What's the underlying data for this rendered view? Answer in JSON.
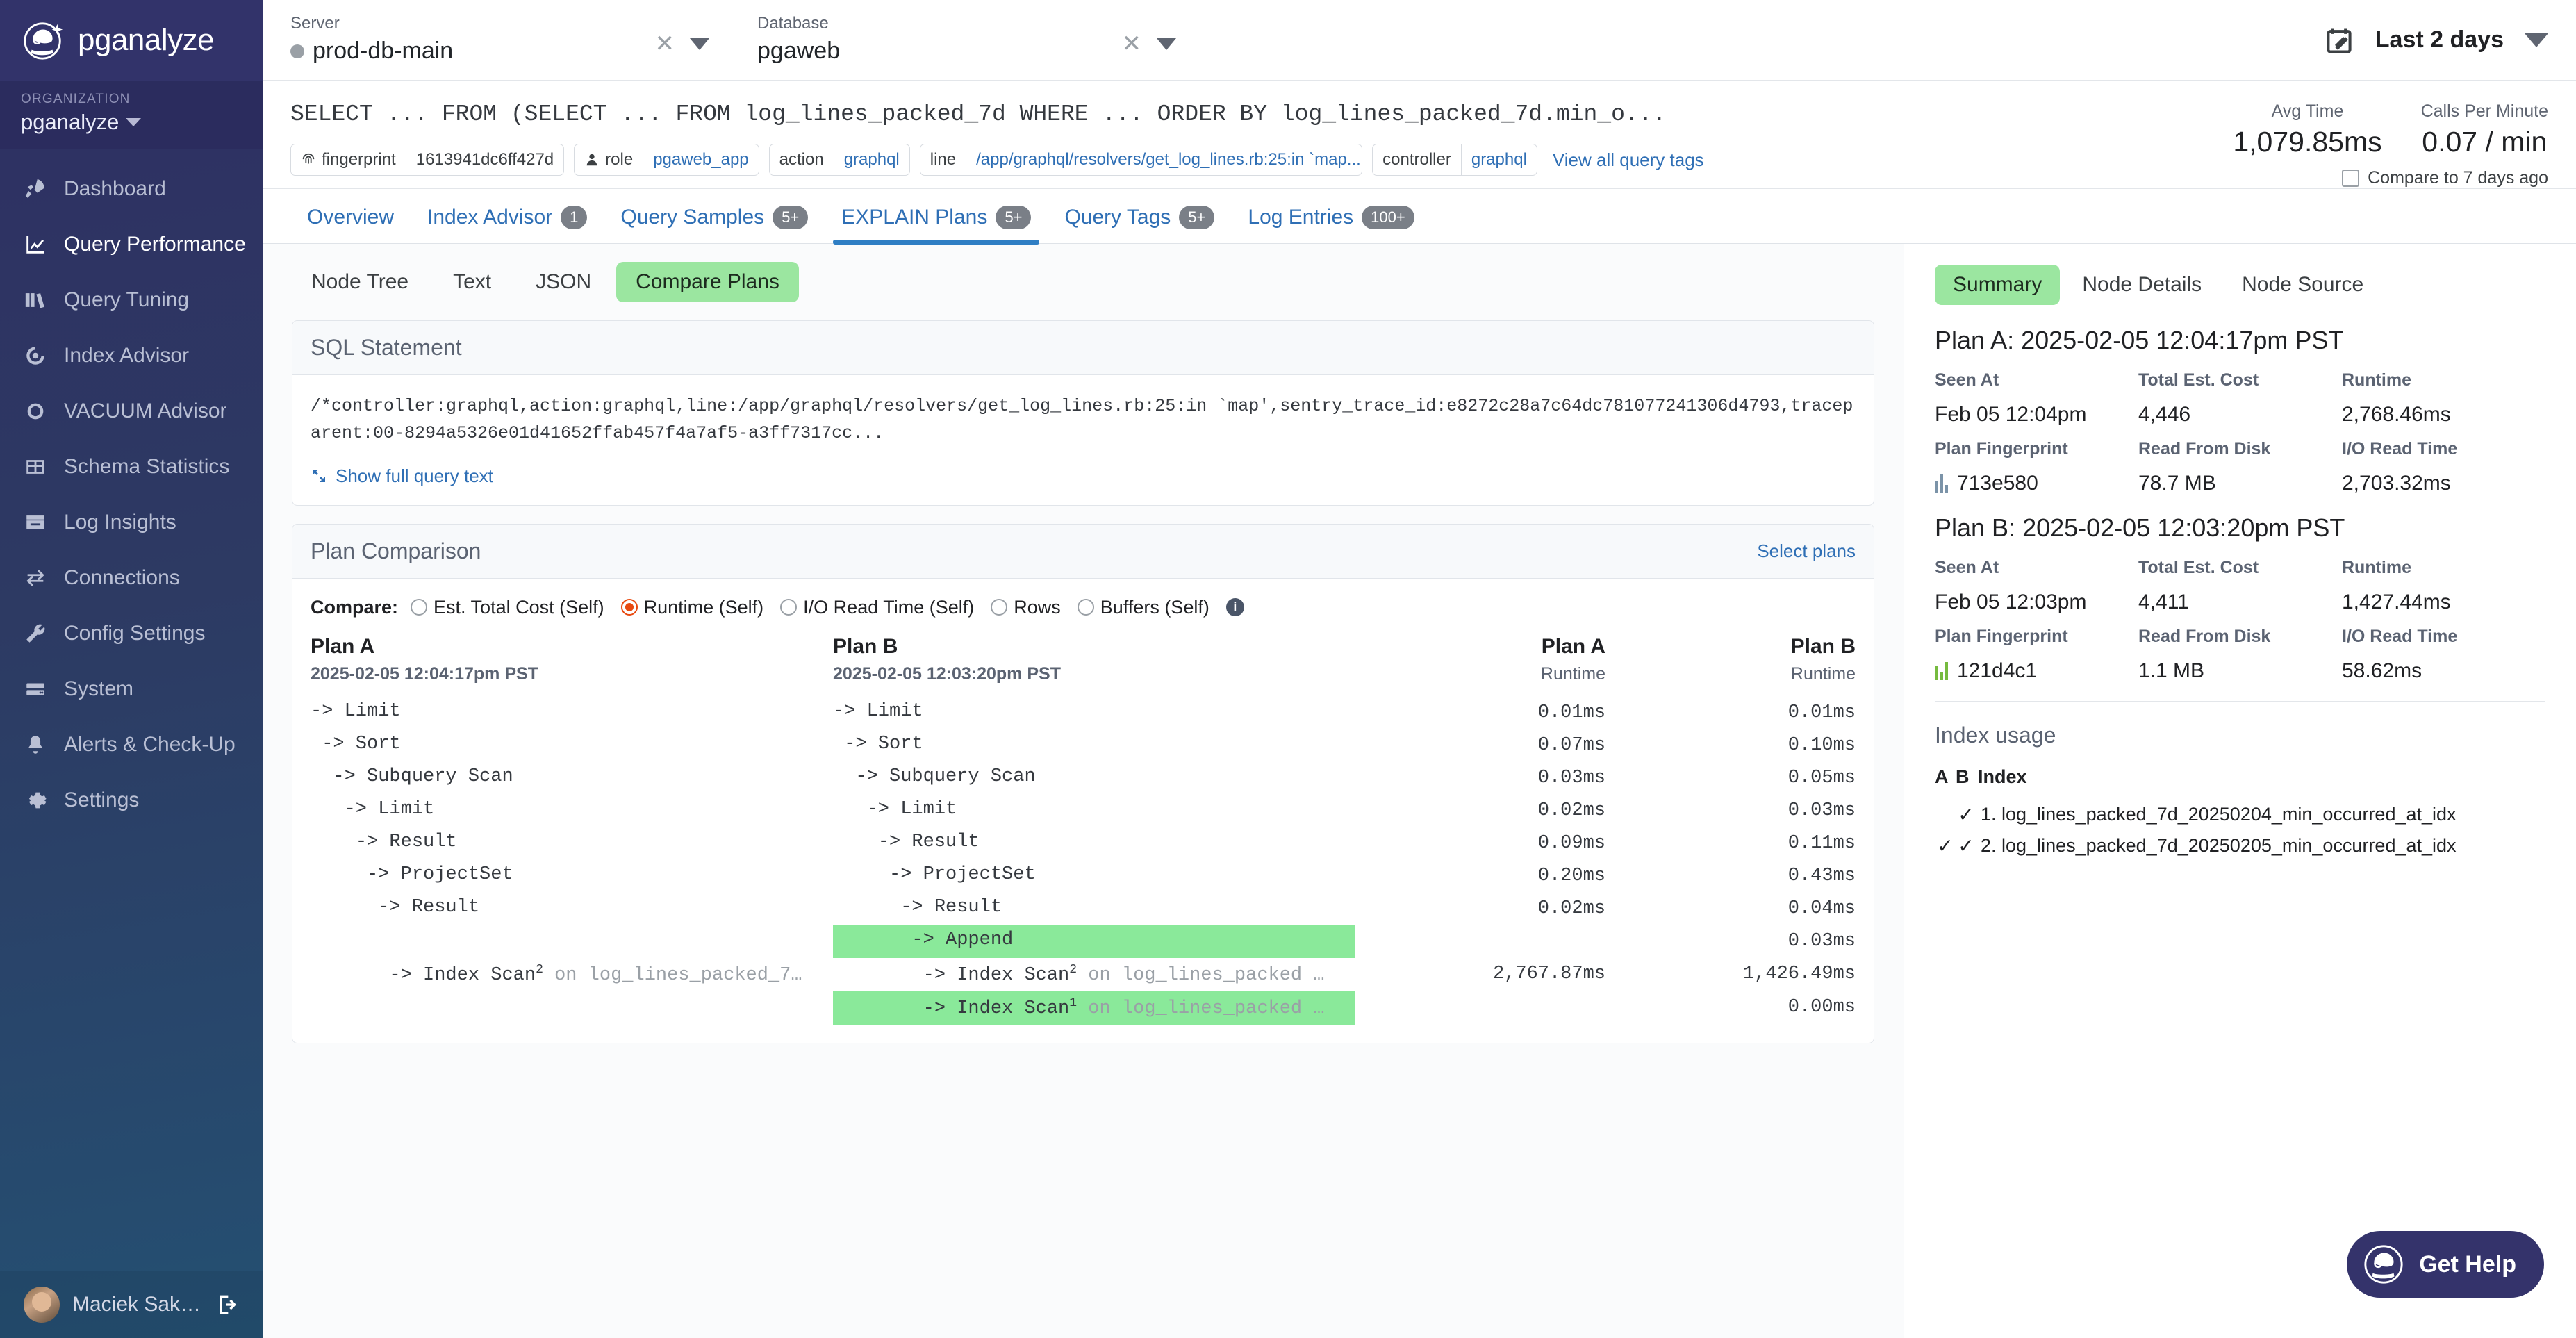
{
  "sidebar": {
    "brand": "pganalyze",
    "brand_logo_icon": "astronaut-helmet-icon",
    "org_label": "ORGANIZATION",
    "org_name": "pganalyze",
    "items": [
      {
        "label": "Dashboard",
        "icon": "rocket-icon",
        "active": false
      },
      {
        "label": "Query Performance",
        "icon": "chart-line-icon",
        "active": true
      },
      {
        "label": "Query Tuning",
        "icon": "books-icon",
        "active": false
      },
      {
        "label": "Index Advisor",
        "icon": "target-icon",
        "active": false
      },
      {
        "label": "VACUUM Advisor",
        "icon": "circle-icon",
        "active": false
      },
      {
        "label": "Schema Statistics",
        "icon": "table-icon",
        "active": false
      },
      {
        "label": "Log Insights",
        "icon": "log-box-icon",
        "active": false
      },
      {
        "label": "Connections",
        "icon": "arrows-swap-icon",
        "active": false
      },
      {
        "label": "Config Settings",
        "icon": "wrench-icon",
        "active": false
      },
      {
        "label": "System",
        "icon": "server-icon",
        "active": false
      },
      {
        "label": "Alerts & Check-Up",
        "icon": "bell-icon",
        "active": false
      },
      {
        "label": "Settings",
        "icon": "gear-icon",
        "active": false
      }
    ],
    "user": {
      "name": "Maciek Sak…",
      "logout_icon": "logout-icon",
      "avatar": "user-avatar"
    }
  },
  "topbar": {
    "server": {
      "label": "Server",
      "value": "prod-db-main",
      "clear_icon": "close-icon",
      "caret_icon": "chevron-down-icon"
    },
    "database": {
      "label": "Database",
      "value": "pgaweb",
      "clear_icon": "close-icon",
      "caret_icon": "chevron-down-icon"
    },
    "daterange": {
      "value": "Last 2 days",
      "calendar_icon": "calendar-edit-icon",
      "caret_icon": "chevron-down-icon"
    }
  },
  "query_header": {
    "title": "SELECT ... FROM (SELECT ... FROM log_lines_packed_7d WHERE ... ORDER BY log_lines_packed_7d.min_o...",
    "tags": [
      {
        "key": "fingerprint",
        "value": "1613941dc6ff427d",
        "icon": "fingerprint-icon",
        "link": false
      },
      {
        "key": "role",
        "value": "pgaweb_app",
        "icon": "user-icon",
        "link": true
      },
      {
        "key": "action",
        "value": "graphql",
        "icon": null,
        "link": true
      },
      {
        "key": "line",
        "value": "/app/graphql/resolvers/get_log_lines.rb:25:in `map...",
        "icon": null,
        "link": true
      },
      {
        "key": "controller",
        "value": "graphql",
        "icon": null,
        "link": true
      }
    ],
    "view_all_tags": "View all query tags",
    "metrics": [
      {
        "label": "Avg Time",
        "value": "1,079.85ms"
      },
      {
        "label": "Calls Per Minute",
        "value": "0.07 / min"
      }
    ],
    "compare_checkbox_label": "Compare to 7 days ago",
    "compare_checkbox_checked": false
  },
  "tabs": [
    {
      "label": "Overview",
      "badge": null,
      "active": false
    },
    {
      "label": "Index Advisor",
      "badge": "1",
      "active": false
    },
    {
      "label": "Query Samples",
      "badge": "5+",
      "active": false
    },
    {
      "label": "EXPLAIN Plans",
      "badge": "5+",
      "active": true
    },
    {
      "label": "Query Tags",
      "badge": "5+",
      "active": false
    },
    {
      "label": "Log Entries",
      "badge": "100+",
      "active": false
    }
  ],
  "subtabs": [
    {
      "label": "Node Tree",
      "active": false
    },
    {
      "label": "Text",
      "active": false
    },
    {
      "label": "JSON",
      "active": false
    },
    {
      "label": "Compare Plans",
      "active": true
    }
  ],
  "sql_panel": {
    "title": "SQL Statement",
    "text": "/*controller:graphql,action:graphql,line:/app/graphql/resolvers/get_log_lines.rb:25:in `map',sentry_trace_id:e8272c28a7c64dc781077241306d4793,traceparent:00-8294a5326e01d41652ffab457f4a7af5-a3ff7317cc...",
    "show_full_label": "Show full query text",
    "show_full_icon": "expand-icon"
  },
  "plan_comparison": {
    "title": "Plan Comparison",
    "select_plans_label": "Select plans",
    "compare_label": "Compare:",
    "compare_options": [
      {
        "label": "Est. Total Cost (Self)",
        "selected": false
      },
      {
        "label": "Runtime (Self)",
        "selected": true
      },
      {
        "label": "I/O Read Time (Self)",
        "selected": false
      },
      {
        "label": "Rows",
        "selected": false
      },
      {
        "label": "Buffers (Self)",
        "selected": false
      }
    ],
    "info_icon": "info-icon",
    "columns": {
      "plan_a": "Plan A",
      "plan_b": "Plan B",
      "plan_a_date": "2025-02-05 12:04:17pm PST",
      "plan_b_date": "2025-02-05 12:03:20pm PST",
      "plan_a_metric": "Runtime",
      "plan_b_metric": "Runtime"
    },
    "rows": [
      {
        "a_indent": 0,
        "a_text": "-> Limit",
        "a_sup": "",
        "a_suffix": "",
        "a_hl": false,
        "b_indent": 0,
        "b_text": "-> Limit",
        "b_sup": "",
        "b_suffix": "",
        "b_hl": false,
        "a_val": "0.01ms",
        "b_val": "0.01ms"
      },
      {
        "a_indent": 1,
        "a_text": "-> Sort",
        "a_sup": "",
        "a_suffix": "",
        "a_hl": false,
        "b_indent": 1,
        "b_text": "-> Sort",
        "b_sup": "",
        "b_suffix": "",
        "b_hl": false,
        "a_val": "0.07ms",
        "b_val": "0.10ms"
      },
      {
        "a_indent": 2,
        "a_text": "-> Subquery Scan",
        "a_sup": "",
        "a_suffix": "",
        "a_hl": false,
        "b_indent": 2,
        "b_text": "-> Subquery Scan",
        "b_sup": "",
        "b_suffix": "",
        "b_hl": false,
        "a_val": "0.03ms",
        "b_val": "0.05ms"
      },
      {
        "a_indent": 3,
        "a_text": "-> Limit",
        "a_sup": "",
        "a_suffix": "",
        "a_hl": false,
        "b_indent": 3,
        "b_text": "-> Limit",
        "b_sup": "",
        "b_suffix": "",
        "b_hl": false,
        "a_val": "0.02ms",
        "b_val": "0.03ms"
      },
      {
        "a_indent": 4,
        "a_text": "-> Result",
        "a_sup": "",
        "a_suffix": "",
        "a_hl": false,
        "b_indent": 4,
        "b_text": "-> Result",
        "b_sup": "",
        "b_suffix": "",
        "b_hl": false,
        "a_val": "0.09ms",
        "b_val": "0.11ms"
      },
      {
        "a_indent": 5,
        "a_text": "-> ProjectSet",
        "a_sup": "",
        "a_suffix": "",
        "a_hl": false,
        "b_indent": 5,
        "b_text": "-> ProjectSet",
        "b_sup": "",
        "b_suffix": "",
        "b_hl": false,
        "a_val": "0.20ms",
        "b_val": "0.43ms"
      },
      {
        "a_indent": 6,
        "a_text": "-> Result",
        "a_sup": "",
        "a_suffix": "",
        "a_hl": false,
        "b_indent": 6,
        "b_text": "-> Result",
        "b_sup": "",
        "b_suffix": "",
        "b_hl": false,
        "a_val": "0.02ms",
        "b_val": "0.04ms"
      },
      {
        "a_indent": 0,
        "a_text": "",
        "a_sup": "",
        "a_suffix": "",
        "a_hl": false,
        "b_indent": 7,
        "b_text": "-> Append",
        "b_sup": "",
        "b_suffix": "",
        "b_hl": true,
        "a_val": "",
        "b_val": "0.03ms"
      },
      {
        "a_indent": 7,
        "a_text": "-> Index Scan",
        "a_sup": "2",
        "a_suffix": " on log_lines_packed_7…",
        "a_hl": false,
        "b_indent": 8,
        "b_text": "-> Index Scan",
        "b_sup": "2",
        "b_suffix": " on log_lines_packed …",
        "b_hl": false,
        "a_val": "2,767.87ms",
        "b_val": "1,426.49ms"
      },
      {
        "a_indent": 0,
        "a_text": "",
        "a_sup": "",
        "a_suffix": "",
        "a_hl": false,
        "b_indent": 8,
        "b_text": "-> Index Scan",
        "b_sup": "1",
        "b_suffix": " on log_lines_packed …",
        "b_hl": true,
        "a_val": "",
        "b_val": "0.00ms"
      }
    ]
  },
  "right_panel": {
    "tabs": [
      {
        "label": "Summary",
        "active": true
      },
      {
        "label": "Node Details",
        "active": false
      },
      {
        "label": "Node Source",
        "active": false
      }
    ],
    "plan_a": {
      "heading": "Plan A: 2025-02-05 12:04:17pm PST",
      "seen_at_label": "Seen At",
      "seen_at": "Feb 05 12:04pm",
      "total_cost_label": "Total Est. Cost",
      "total_cost": "4,446",
      "runtime_label": "Runtime",
      "runtime": "2,768.46ms",
      "fingerprint_label": "Plan Fingerprint",
      "fingerprint": "713e580",
      "read_disk_label": "Read From Disk",
      "read_disk": "78.7 MB",
      "io_time_label": "I/O Read Time",
      "io_time": "2,703.32ms"
    },
    "plan_b": {
      "heading": "Plan B: 2025-02-05 12:03:20pm PST",
      "seen_at_label": "Seen At",
      "seen_at": "Feb 05 12:03pm",
      "total_cost_label": "Total Est. Cost",
      "total_cost": "4,411",
      "runtime_label": "Runtime",
      "runtime": "1,427.44ms",
      "fingerprint_label": "Plan Fingerprint",
      "fingerprint": "121d4c1",
      "read_disk_label": "Read From Disk",
      "read_disk": "1.1 MB",
      "io_time_label": "I/O Read Time",
      "io_time": "58.62ms"
    },
    "index_usage": {
      "title": "Index usage",
      "header": {
        "a": "A",
        "b": "B",
        "index": "Index"
      },
      "rows": [
        {
          "a": false,
          "b": true,
          "name": "1. log_lines_packed_7d_20250204_min_occurred_at_idx"
        },
        {
          "a": true,
          "b": true,
          "name": "2. log_lines_packed_7d_20250205_min_occurred_at_idx"
        }
      ]
    }
  },
  "get_help": {
    "label": "Get Help",
    "icon": "astronaut-helmet-icon"
  },
  "colors": {
    "sidebar_top": "#2e2f63",
    "sidebar_bottom": "#245072",
    "accent_blue": "#2f6fb5",
    "highlight_green": "#8ae99a",
    "pill_green": "#9be6a0",
    "radio_orange": "#e8490f",
    "badge_gray": "#7a7f87"
  }
}
